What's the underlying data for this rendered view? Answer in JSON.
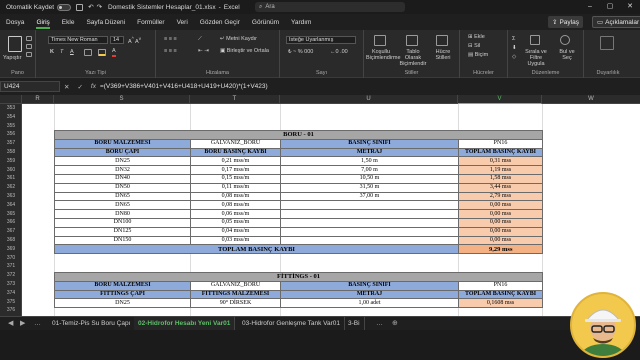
{
  "titlebar": {
    "autosave_label": "Otomatik Kaydet",
    "filename": "Domestik Sistemler Hesaplar_01.xlsx",
    "app": "Excel",
    "search_placeholder": "Ara"
  },
  "menu": {
    "tabs": [
      "Dosya",
      "Giriş",
      "Ekle",
      "Sayfa Düzeni",
      "Formüller",
      "Veri",
      "Gözden Geçir",
      "Görünüm",
      "Yardım"
    ],
    "active": "Giriş",
    "share_label": "Paylaş",
    "comments_label": "Açıklamalar"
  },
  "ribbon": {
    "paste_label": "Yapıştır",
    "font_name": "Times New Roman",
    "font_size": "14",
    "wrap_label": "Metni Kaydır",
    "merge_label": "Birleştir ve Ortala",
    "number_format": "İsteğe Uyarlanmış",
    "cond_format_label": "Koşullu Biçimlendirme",
    "table_format_label": "Tablo Olarak Biçimlendir",
    "cell_styles_label": "Hücre Stilleri",
    "insert_label": "Ekle",
    "delete_label": "Sil",
    "format_label": "Biçim",
    "sort_label": "Sırala ve Filtre Uygula",
    "find_label": "Bul ve Seç",
    "groups": [
      "Pano",
      "Yazı Tipi",
      "Hizalama",
      "Sayı",
      "Stiller",
      "Hücreler",
      "Düzenleme",
      "Duyarlılık"
    ]
  },
  "formula_bar": {
    "cell_ref": "U424",
    "fx": "fx",
    "formula": "=(V369+V386+V401+V416+U418+U419+U420)*(1+V423)"
  },
  "columns": [
    "R",
    "S",
    "T",
    "U",
    "V",
    "W"
  ],
  "rows": [
    "353",
    "354",
    "355",
    "356",
    "357",
    "358",
    "359",
    "360",
    "361",
    "362",
    "363",
    "364",
    "365",
    "366",
    "367",
    "368",
    "369",
    "370",
    "371",
    "372",
    "373",
    "374",
    "375",
    "376"
  ],
  "boru_block": {
    "title": "BORU - 01",
    "row1": [
      "BORU MALZEMESİ",
      "GALVANİZ_BORU",
      "BASINÇ SINIFI",
      "PN16"
    ],
    "header": [
      "BORU ÇAPI",
      "BORU BASINÇ KAYBI",
      "METRAJ",
      "TOPLAM BASINÇ KAYBI"
    ],
    "rows": [
      [
        "DN25",
        "0,21 mss/m",
        "1,50 m",
        "0,31 mss"
      ],
      [
        "DN32",
        "0,17 mss/m",
        "7,00 m",
        "1,19 mss"
      ],
      [
        "DN40",
        "0,15 mss/m",
        "10,50 m",
        "1,58 mss"
      ],
      [
        "DN50",
        "0,11 mss/m",
        "31,50 m",
        "3,44 mss"
      ],
      [
        "DN65",
        "0,08 mss/m",
        "37,00 m",
        "2,79 mss"
      ],
      [
        "DN65",
        "0,08 mss/m",
        "",
        "0,00 mss"
      ],
      [
        "DN80",
        "0,06 mss/m",
        "",
        "0,00 mss"
      ],
      [
        "DN100",
        "0,05 mss/m",
        "",
        "0,00 mss"
      ],
      [
        "DN125",
        "0,04 mss/m",
        "",
        "0,00 mss"
      ],
      [
        "DN150",
        "0,03 mss/m",
        "",
        "0,00 mss"
      ]
    ],
    "total_label": "TOPLAM BASINÇ KAYBI",
    "total_value": "9,29 mss"
  },
  "fittings_block": {
    "title": "FİTTİNGS - 01",
    "row1": [
      "BORU MALZEMESİ",
      "GALVANİZ_BORU",
      "BASINÇ SINIFI",
      "PN16"
    ],
    "header": [
      "FİTTİNGS ÇAPI",
      "FİTTİNGS MALZEMESİ",
      "METRAJ",
      "TOPLAM BASINÇ KAYBI"
    ],
    "rows": [
      [
        "DN25",
        "90° DİRSEK",
        "1,00 adet",
        "0,1608 mss"
      ]
    ]
  },
  "sheet_tabs": [
    "01-Temiz-Pis Su Boru Çapı",
    "02-Hidrofor Hesabı Yeni Var01",
    "03-Hidrofor Genleşme Tank Var01",
    "3-Bi"
  ],
  "active_sheet_tab": "02-Hidrofor Hesabı Yeni Var01",
  "colors": {
    "accent": "#4caf50",
    "header_blue": "#8eaadb",
    "title_gray": "#a6a6a6",
    "result_orange": "#f8cbad",
    "total_orange": "#f4b183"
  }
}
